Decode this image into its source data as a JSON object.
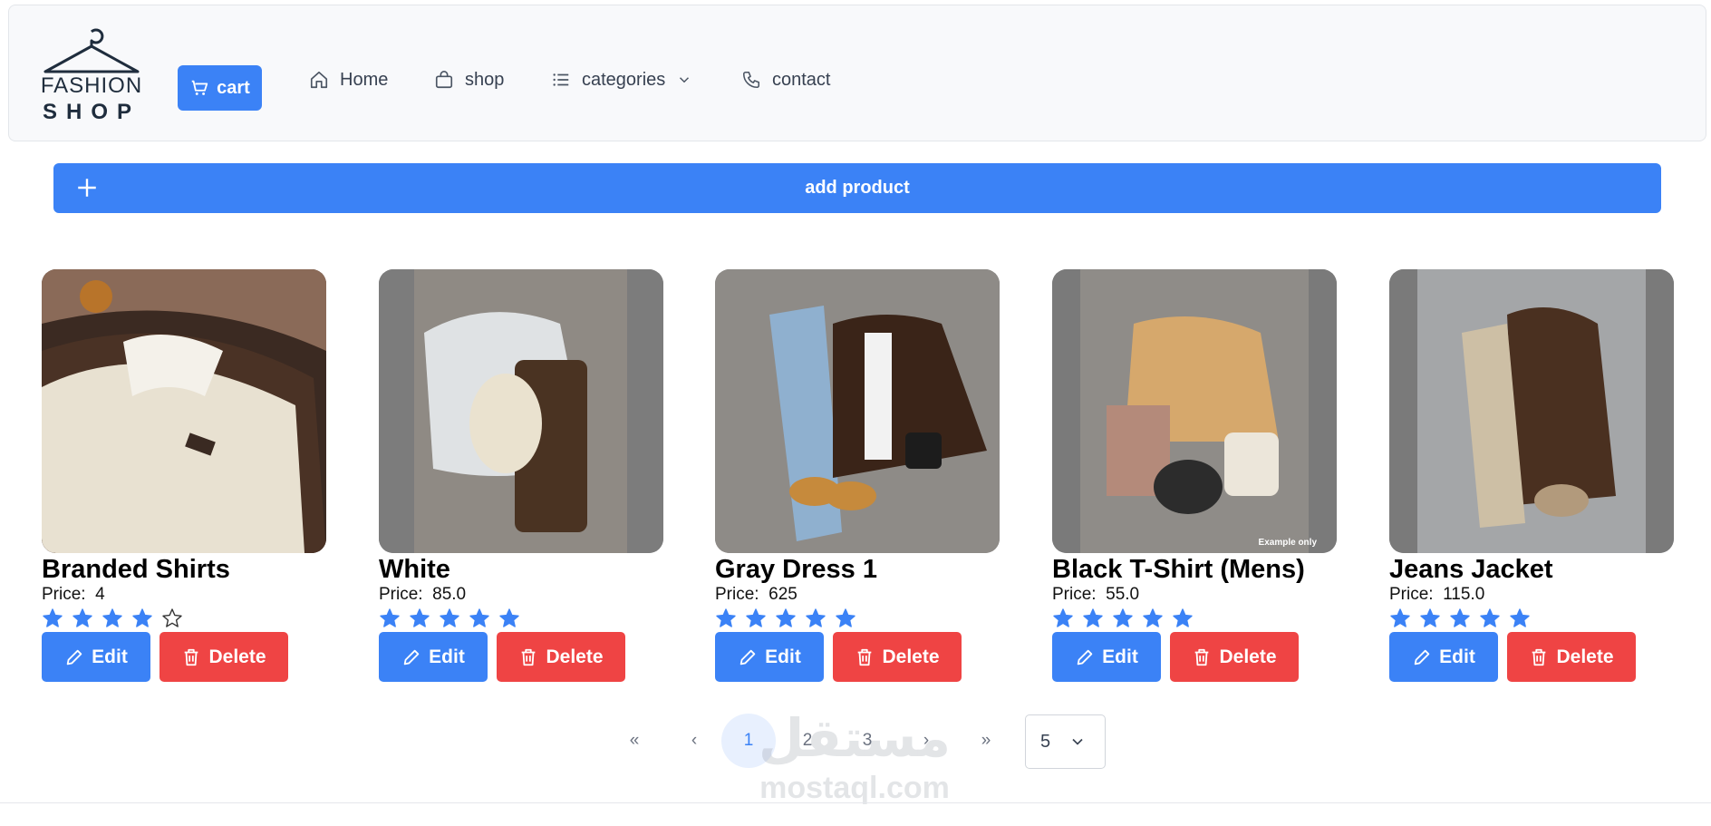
{
  "brand": {
    "line1": "FASHION",
    "line2": "SHOP"
  },
  "nav": {
    "cart_label": "cart",
    "items": [
      {
        "label": "Home",
        "icon": "home-icon"
      },
      {
        "label": "shop",
        "icon": "shopping-bag-icon"
      },
      {
        "label": "categories",
        "icon": "list-icon"
      },
      {
        "label": "contact",
        "icon": "phone-icon"
      }
    ]
  },
  "add_product_label": "add product",
  "products": [
    {
      "name": "Branded Shirts",
      "price_label": "Price:",
      "price": "4",
      "rating": 4,
      "edit_label": "Edit",
      "delete_label": "Delete"
    },
    {
      "name": "White",
      "price_label": "Price:",
      "price": "85.0",
      "rating": 5,
      "edit_label": "Edit",
      "delete_label": "Delete"
    },
    {
      "name": "Gray Dress 1",
      "price_label": "Price:",
      "price": "625",
      "rating": 5,
      "edit_label": "Edit",
      "delete_label": "Delete"
    },
    {
      "name": "Black T-Shirt (Mens)",
      "price_label": "Price:",
      "price": "55.0",
      "rating": 5,
      "edit_label": "Edit",
      "delete_label": "Delete",
      "image_caption": "Example only"
    },
    {
      "name": "Jeans Jacket",
      "price_label": "Price:",
      "price": "115.0",
      "rating": 5,
      "edit_label": "Edit",
      "delete_label": "Delete"
    }
  ],
  "pagination": {
    "first": "«",
    "prev": "‹",
    "pages": [
      "1",
      "2",
      "3"
    ],
    "active_page": "1",
    "next": "›",
    "last": "»",
    "page_size": "5"
  },
  "watermark": {
    "arabic": "مستقل",
    "latin": "mostaql.com"
  },
  "colors": {
    "primary": "#3b82f6",
    "danger": "#ef4444",
    "star": "#3b82f6"
  }
}
